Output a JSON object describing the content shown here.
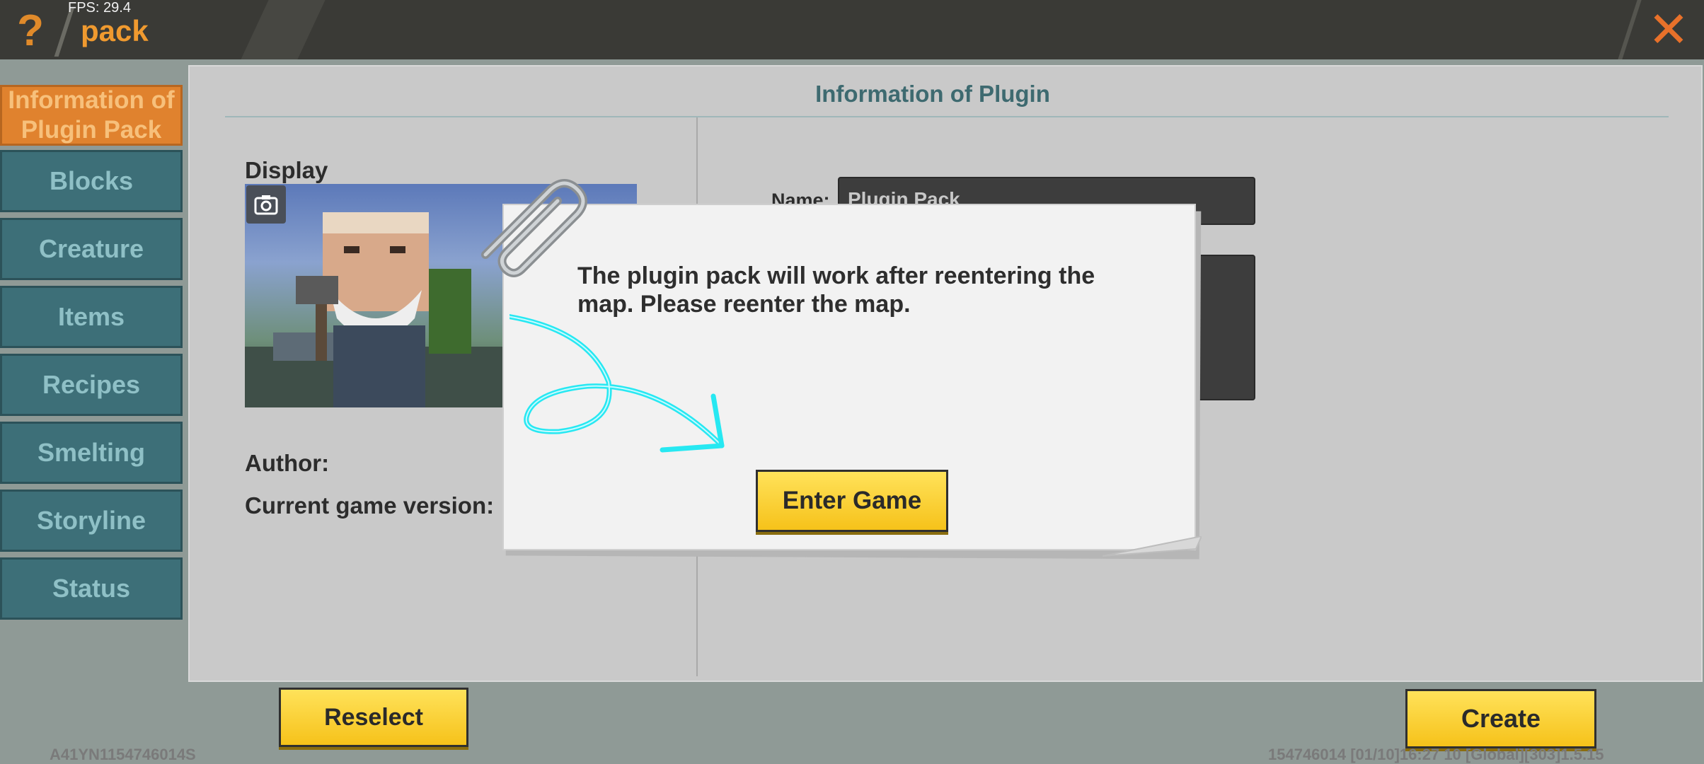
{
  "topbar": {
    "fps": "FPS: 29.4",
    "help_icon": "?",
    "title": "pack",
    "close_icon": "✕"
  },
  "sidebar": {
    "items": [
      {
        "label": "Information of Plugin Pack",
        "active": true
      },
      {
        "label": "Blocks",
        "active": false
      },
      {
        "label": "Creature",
        "active": false
      },
      {
        "label": "Items",
        "active": false
      },
      {
        "label": "Recipes",
        "active": false
      },
      {
        "label": "Smelting",
        "active": false
      },
      {
        "label": "Storyline",
        "active": false
      },
      {
        "label": "Status",
        "active": false
      }
    ]
  },
  "panel": {
    "title": "Information of Plugin",
    "display_label": "Display",
    "author_label": "Author:",
    "version_label": "Current game version:",
    "name_label": "Name:",
    "name_value": "Plugin Pack"
  },
  "dialog": {
    "message": "The plugin pack will work after reentering the map. Please reenter the map.",
    "enter_game_label": "Enter Game"
  },
  "buttons": {
    "reselect_label": "Reselect",
    "create_label": "Create"
  },
  "footer": {
    "device_id": "A41YN1154746014S",
    "build_info": "154746014   [01/10]16:27 10 [Global][303]1.5.15"
  },
  "colors": {
    "accent_orange": "#e0822e",
    "sidebar_teal": "#3d6f78",
    "button_yellow": "#f6c21a",
    "arrow_cyan": "#27e8f2"
  }
}
